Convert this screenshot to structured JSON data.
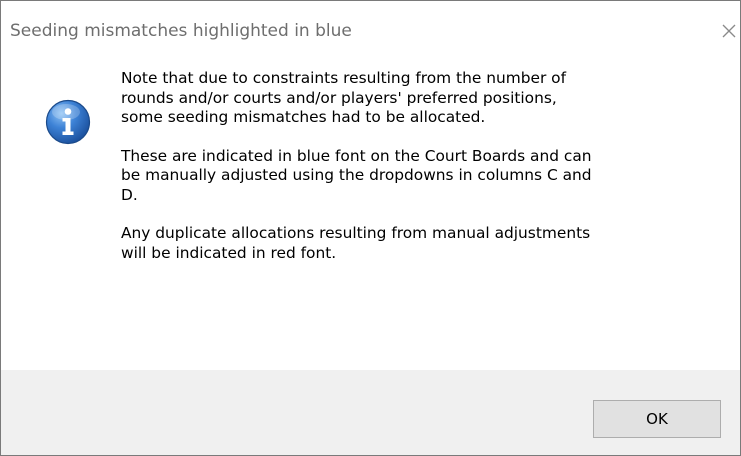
{
  "window": {
    "title": "Seeding mismatches highlighted in blue",
    "close_glyph": "✕"
  },
  "message": {
    "icon": "info-icon",
    "paragraphs": [
      {
        "lines": [
          "Note that due to constraints resulting from the number of",
          "rounds and/or courts and/or players' preferred positions,",
          "some seeding mismatches had to be allocated."
        ]
      },
      {
        "lines": [
          "These are indicated in blue font on the Court Boards and can",
          "be manually adjusted using the dropdowns in columns C and",
          "D."
        ]
      },
      {
        "lines": [
          "Any duplicate allocations resulting from manual adjustments",
          "will be indicated in red font."
        ]
      }
    ]
  },
  "buttons": {
    "ok_label": "OK"
  },
  "colors": {
    "title_text": "#6e6e6e",
    "footer_background": "#f0f0f0",
    "button_background": "#e1e1e1",
    "button_border": "#adadad",
    "icon_blue": "#1f5fb8"
  }
}
